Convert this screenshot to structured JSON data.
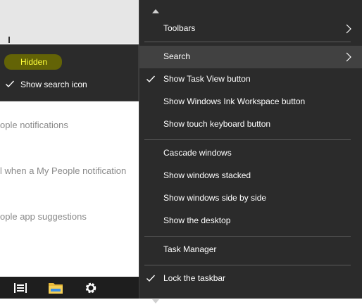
{
  "background_page": {
    "lines": [
      "ople notifications",
      "l when a My People notification",
      "ople app suggestions"
    ]
  },
  "search_submenu": {
    "items": [
      {
        "label": "Hidden",
        "checked": false,
        "highlighted": true
      },
      {
        "label": "Show search icon",
        "checked": true,
        "highlighted": false
      }
    ]
  },
  "context_menu": {
    "items": [
      {
        "label": "Toolbars",
        "submenu": true
      },
      {
        "label": "Search",
        "submenu": true,
        "active": true
      },
      {
        "label": "Show Task View button",
        "checked": true
      },
      {
        "label": "Show Windows Ink Workspace button"
      },
      {
        "label": "Show touch keyboard button"
      },
      {
        "label": "Cascade windows"
      },
      {
        "label": "Show windows stacked"
      },
      {
        "label": "Show windows side by side"
      },
      {
        "label": "Show the desktop"
      },
      {
        "label": "Task Manager"
      },
      {
        "label": "Lock the taskbar",
        "checked": true
      }
    ]
  },
  "taskbar": {
    "icons": [
      "task-view-icon",
      "file-explorer-icon",
      "settings-gear-icon"
    ]
  },
  "colors": {
    "menu_bg": "#2b2b2b",
    "menu_active": "#414141",
    "highlight_text": "#ffff3a",
    "taskbar_bg": "#1e1e1e"
  }
}
